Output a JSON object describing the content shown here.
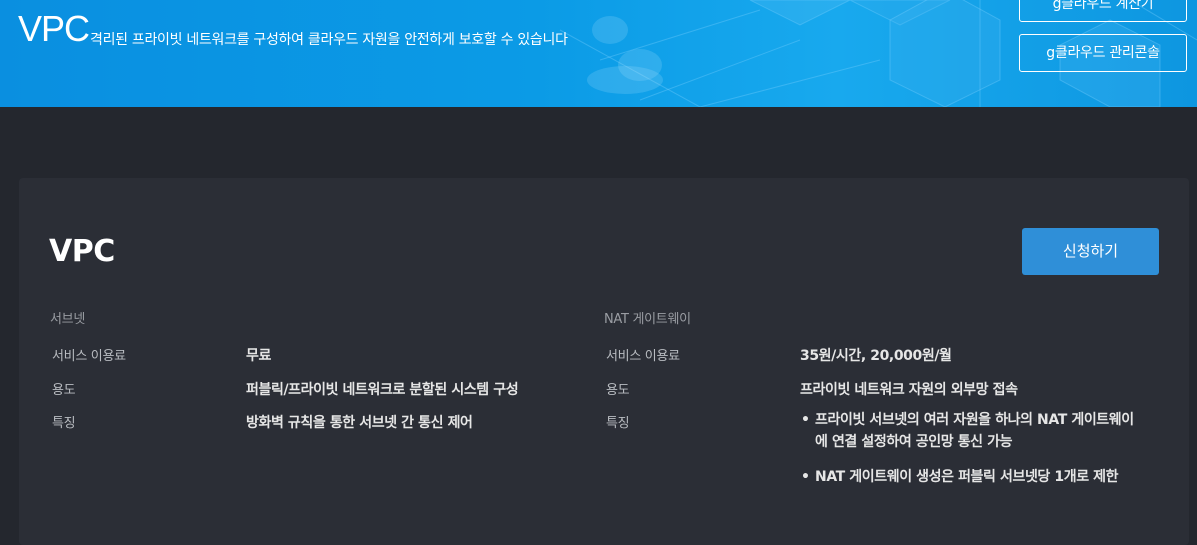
{
  "hero": {
    "title": "VPC",
    "description": "격리된 프라이빗 네트워크를 구성하여 클라우드 자원을 안전하게 보호할 수 있습니다",
    "calculator_button": "g클라우드 계산기",
    "console_button": "g클라우드 관리콘솔"
  },
  "card": {
    "title": "VPC",
    "apply_button": "신청하기",
    "subnet": {
      "label": "서브넷",
      "rows": [
        {
          "key": "서비스 이용료",
          "value": "무료"
        },
        {
          "key": "용도",
          "value": "퍼블릭/프라이빗 네트워크로 분할된 시스템 구성"
        },
        {
          "key": "특징",
          "value": "방화벽 규칙을 통한 서브넷 간 통신 제어"
        }
      ]
    },
    "nat": {
      "label": "NAT 게이트웨이",
      "rows": [
        {
          "key": "서비스 이용료",
          "value": "35원/시간, 20,000원/월"
        },
        {
          "key": "용도",
          "value": "프라이빗 네트워크 자원의 외부망 접속"
        },
        {
          "key": "특징",
          "bullets": [
            "프라이빗 서브넷의 여러 자원을 하나의 NAT 게이트웨이에 연결 설정하여 공인망 통신 가능",
            "NAT 게이트웨이 생성은 퍼블릭 서브넷당 1개로 제한"
          ]
        }
      ]
    }
  },
  "colors": {
    "hero_blue": "#0b9be6",
    "page_bg": "#24272e",
    "card_bg": "#2b2e36",
    "accent_button": "#2f8fd8"
  }
}
